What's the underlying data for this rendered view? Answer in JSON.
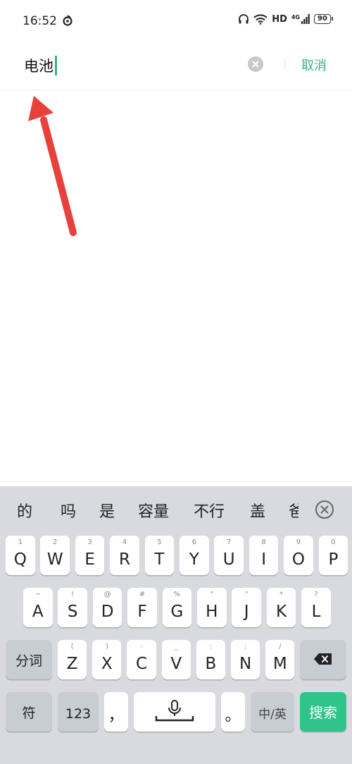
{
  "status_bar": {
    "time": "16:52",
    "network": "HD",
    "signal_label": "4G",
    "battery": "90"
  },
  "search": {
    "query": "电池",
    "cancel_label": "取消",
    "accent_color": "#35b57c"
  },
  "keyboard": {
    "candidates": [
      "的",
      "吗",
      "是",
      "容量",
      "不行",
      "盖",
      "爸"
    ],
    "row1": [
      {
        "key": "Q",
        "sub": "1"
      },
      {
        "key": "W",
        "sub": "2"
      },
      {
        "key": "E",
        "sub": "3"
      },
      {
        "key": "R",
        "sub": "4"
      },
      {
        "key": "T",
        "sub": "5"
      },
      {
        "key": "Y",
        "sub": "6"
      },
      {
        "key": "U",
        "sub": "7"
      },
      {
        "key": "I",
        "sub": "8"
      },
      {
        "key": "O",
        "sub": "9"
      },
      {
        "key": "P",
        "sub": "0"
      }
    ],
    "row2": [
      {
        "key": "A",
        "sub": "~"
      },
      {
        "key": "S",
        "sub": "!"
      },
      {
        "key": "D",
        "sub": "@"
      },
      {
        "key": "F",
        "sub": "#"
      },
      {
        "key": "G",
        "sub": "%"
      },
      {
        "key": "H",
        "sub": "\""
      },
      {
        "key": "J",
        "sub": "\""
      },
      {
        "key": "K",
        "sub": "*"
      },
      {
        "key": "L",
        "sub": "?"
      }
    ],
    "row3": [
      {
        "key": "Z",
        "sub": "("
      },
      {
        "key": "X",
        "sub": ")"
      },
      {
        "key": "C",
        "sub": "-"
      },
      {
        "key": "V",
        "sub": "_"
      },
      {
        "key": "B",
        "sub": ":"
      },
      {
        "key": "N",
        "sub": ";"
      },
      {
        "key": "M",
        "sub": "/"
      }
    ],
    "segment_label": "分词",
    "symbol_label": "符",
    "numbers_label": "123",
    "comma_label": "，",
    "period_label": "。",
    "lang_label": "中/英",
    "search_label": "搜索",
    "search_key_color": "#2fc48a"
  }
}
